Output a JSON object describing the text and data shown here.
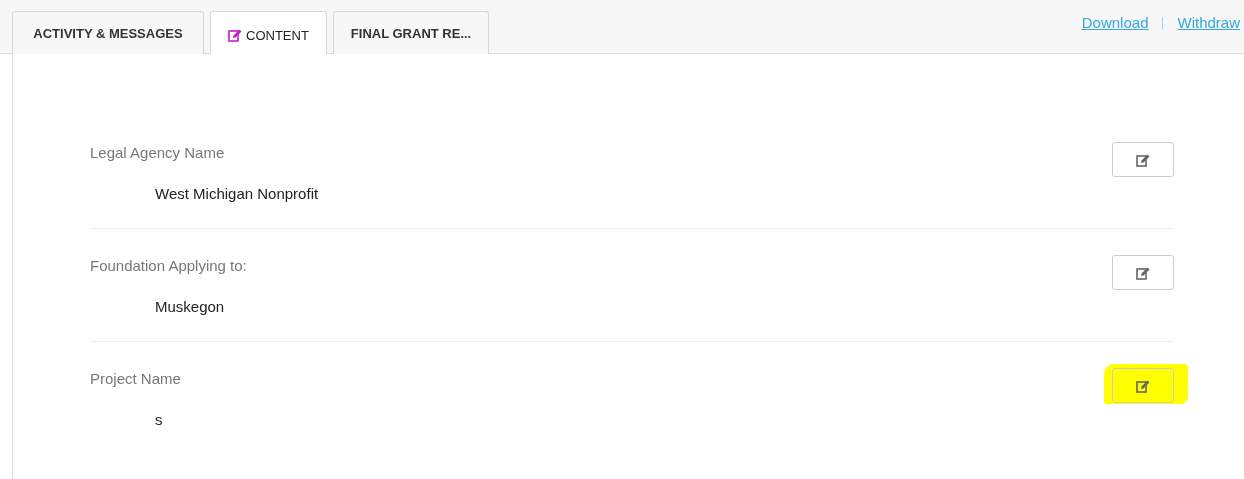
{
  "tabs": [
    {
      "label": "ACTIVITY & MESSAGES",
      "selected": false,
      "icon": false
    },
    {
      "label": "CONTENT",
      "selected": true,
      "icon": true
    },
    {
      "label": "FINAL GRANT RE...",
      "selected": false,
      "icon": false
    }
  ],
  "links": [
    "Download",
    "Withdraw"
  ],
  "fields": [
    {
      "label": "Legal Agency Name",
      "value": "West Michigan Nonprofit",
      "highlighted": false
    },
    {
      "label": "Foundation Applying to:",
      "value": "Muskegon",
      "highlighted": false
    },
    {
      "label": "Project Name",
      "value": "s",
      "highlighted": true
    }
  ]
}
